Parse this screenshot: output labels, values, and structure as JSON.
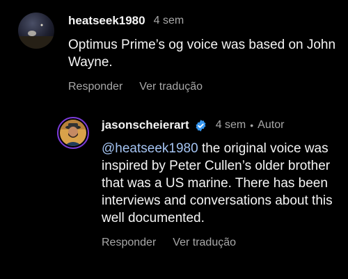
{
  "comment1": {
    "username": "heatseek1980",
    "time": "4 sem",
    "text": "Optimus Prime’s og voice was based on John Wayne.",
    "reply_label": "Responder",
    "translate_label": "Ver tradução"
  },
  "comment2": {
    "username": "jasonscheierart",
    "time": "4 sem",
    "separator": "•",
    "author_badge": "Autor",
    "mention": "@heatseek1980",
    "text": " the original voice was inspired by Peter Cullen’s older brother that was a US marine. There has been interviews and conversations about this well documented.",
    "reply_label": "Responder",
    "translate_label": "Ver tradução"
  },
  "colors": {
    "background": "#000000",
    "text": "#f5f5f5",
    "muted": "#a8a8a8",
    "mention": "#a5c4f2",
    "verified": "#3797f0",
    "story_ring": "#7a3bd6"
  }
}
